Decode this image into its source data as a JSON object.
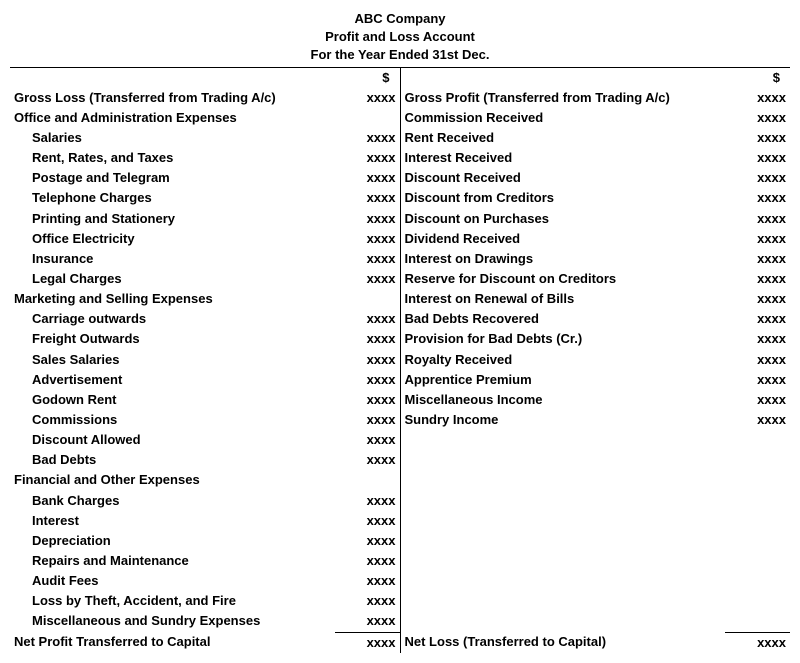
{
  "header": {
    "company": "ABC Company",
    "title": "Profit and Loss Account",
    "period": "For the Year Ended 31st Dec."
  },
  "currency": "$",
  "amt": "xxxx",
  "left": {
    "r0": "Gross Loss (Transferred from Trading A/c)",
    "h1": "Office and Administration Expenses",
    "i1": "Salaries",
    "i2": "Rent, Rates, and Taxes",
    "i3": "Postage and Telegram",
    "i4": "Telephone Charges",
    "i5": "Printing and Stationery",
    "i6": "Office Electricity",
    "i7": "Insurance",
    "i8": "Legal Charges",
    "h2": "Marketing and Selling Expenses",
    "i9": "Carriage outwards",
    "i10": "Freight Outwards",
    "i11": "Sales Salaries",
    "i12": "Advertisement",
    "i13": "Godown Rent",
    "i14": "Commissions",
    "i15": "Discount Allowed",
    "i16": "Bad Debts",
    "h3": "Financial and Other Expenses",
    "i17": "Bank Charges",
    "i18": "Interest",
    "i19": "Depreciation",
    "i20": "Repairs and Maintenance",
    "i21": "Audit Fees",
    "i22": "Loss by Theft, Accident, and Fire",
    "i23": "Miscellaneous and Sundry Expenses",
    "r99": "Net Profit Transferred to Capital"
  },
  "right": {
    "r0": "Gross Profit (Transferred from Trading A/c)",
    "r1": "Commission Received",
    "r2": "Rent Received",
    "r3": "Interest Received",
    "r4": "Discount Received",
    "r5": "Discount from Creditors",
    "r6": "Discount on Purchases",
    "r7": "Dividend Received",
    "r8": "Interest on Drawings",
    "r9": "Reserve for Discount on Creditors",
    "r10": "Interest on Renewal of Bills",
    "r11": "Bad Debts Recovered",
    "r12": "Provision for Bad Debts (Cr.)",
    "r13": "Royalty Received",
    "r14": "Apprentice Premium",
    "r15": "Miscellaneous Income",
    "r16": "Sundry Income",
    "r99": "Net Loss (Transferred to Capital)"
  }
}
